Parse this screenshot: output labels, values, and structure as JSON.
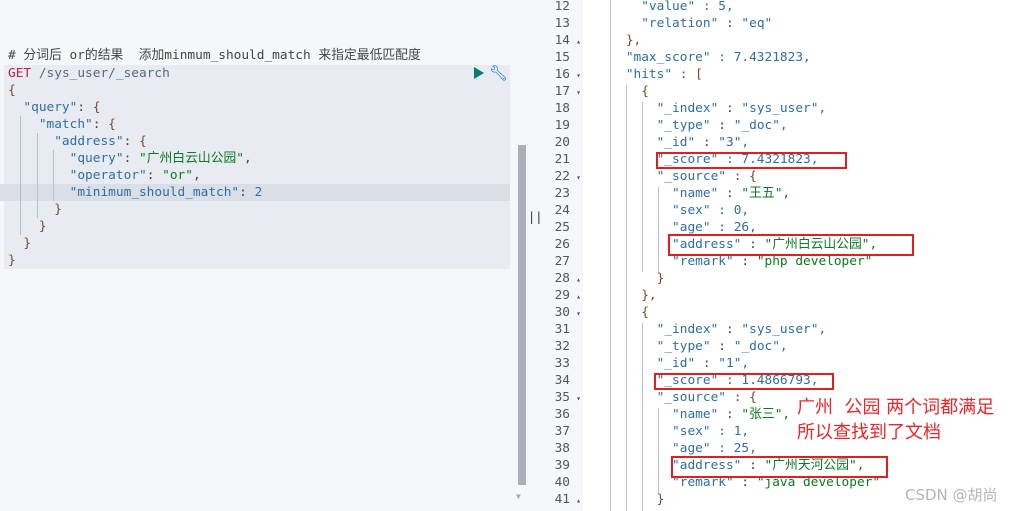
{
  "request": {
    "comment": "# 分词后 or的结果  添加minmum_should_match 来指定最低匹配度",
    "method": "GET",
    "path": " /sys_user/_search",
    "lines": [
      [
        {
          "t": "{",
          "c": "b"
        }
      ],
      [
        {
          "t": "  \"query\"",
          "c": "k"
        },
        {
          "t": ": ",
          "c": "p"
        },
        {
          "t": "{",
          "c": "b"
        }
      ],
      [
        {
          "t": "    \"match\"",
          "c": "k"
        },
        {
          "t": ": ",
          "c": "p"
        },
        {
          "t": "{",
          "c": "b"
        }
      ],
      [
        {
          "t": "      \"address\"",
          "c": "k"
        },
        {
          "t": ": ",
          "c": "p"
        },
        {
          "t": "{",
          "c": "b"
        }
      ],
      [
        {
          "t": "        \"query\"",
          "c": "k"
        },
        {
          "t": ": ",
          "c": "p"
        },
        {
          "t": "\"广州白云山公园\"",
          "c": "cn"
        },
        {
          "t": ",",
          "c": "p"
        }
      ],
      [
        {
          "t": "        \"operator\"",
          "c": "k"
        },
        {
          "t": ": ",
          "c": "p"
        },
        {
          "t": "\"or\"",
          "c": "cn"
        },
        {
          "t": ",",
          "c": "p"
        }
      ],
      [
        {
          "t": "        \"minimum_should_match\"",
          "c": "k"
        },
        {
          "t": ": ",
          "c": "p"
        },
        {
          "t": "2",
          "c": "n"
        }
      ],
      [
        {
          "t": "      }",
          "c": "b"
        }
      ],
      [
        {
          "t": "    }",
          "c": "b"
        }
      ],
      [
        {
          "t": "  }",
          "c": "b"
        }
      ],
      [
        {
          "t": "}",
          "c": "b"
        }
      ]
    ],
    "run_icon": "play-icon",
    "settings_icon": "wrench-icon"
  },
  "divider_label": "||",
  "response": {
    "lines": [
      {
        "n": "12",
        "f": "",
        "parts": [
          {
            "t": "      \"value\"",
            "c": "k"
          },
          {
            "t": " : 5,",
            "c": "n"
          }
        ]
      },
      {
        "n": "13",
        "f": "",
        "parts": [
          {
            "t": "      \"relation\"",
            "c": "k"
          },
          {
            "t": " : ",
            "c": "p"
          },
          {
            "t": "\"eq\"",
            "c": "s"
          }
        ]
      },
      {
        "n": "14",
        "f": "▴",
        "parts": [
          {
            "t": "    },",
            "c": "b"
          }
        ]
      },
      {
        "n": "15",
        "f": "",
        "parts": [
          {
            "t": "    \"max_score\"",
            "c": "k"
          },
          {
            "t": " : 7.4321823,",
            "c": "n"
          }
        ]
      },
      {
        "n": "16",
        "f": "▾",
        "parts": [
          {
            "t": "    \"hits\"",
            "c": "k"
          },
          {
            "t": " : [",
            "c": "b"
          }
        ]
      },
      {
        "n": "17",
        "f": "▾",
        "parts": [
          {
            "t": "      {",
            "c": "b"
          }
        ]
      },
      {
        "n": "18",
        "f": "",
        "parts": [
          {
            "t": "        \"_index\"",
            "c": "k"
          },
          {
            "t": " : ",
            "c": "p"
          },
          {
            "t": "\"sys_user\",",
            "c": "s"
          }
        ]
      },
      {
        "n": "19",
        "f": "",
        "parts": [
          {
            "t": "        \"_type\"",
            "c": "k"
          },
          {
            "t": " : ",
            "c": "p"
          },
          {
            "t": "\"_doc\",",
            "c": "s"
          }
        ]
      },
      {
        "n": "20",
        "f": "",
        "parts": [
          {
            "t": "        \"_id\"",
            "c": "k"
          },
          {
            "t": " : ",
            "c": "p"
          },
          {
            "t": "\"3\",",
            "c": "s"
          }
        ]
      },
      {
        "n": "21",
        "f": "",
        "parts": [
          {
            "t": "        \"_score\"",
            "c": "k"
          },
          {
            "t": " : 7.4321823,",
            "c": "n"
          }
        ]
      },
      {
        "n": "22",
        "f": "▾",
        "parts": [
          {
            "t": "        \"_source\"",
            "c": "k"
          },
          {
            "t": " : {",
            "c": "b"
          }
        ]
      },
      {
        "n": "23",
        "f": "",
        "parts": [
          {
            "t": "          \"name\"",
            "c": "k"
          },
          {
            "t": " : ",
            "c": "p"
          },
          {
            "t": "\"王五\",",
            "c": "cn"
          }
        ]
      },
      {
        "n": "24",
        "f": "",
        "parts": [
          {
            "t": "          \"sex\"",
            "c": "k"
          },
          {
            "t": " : 0,",
            "c": "n"
          }
        ]
      },
      {
        "n": "25",
        "f": "",
        "parts": [
          {
            "t": "          \"age\"",
            "c": "k"
          },
          {
            "t": " : 26,",
            "c": "n"
          }
        ]
      },
      {
        "n": "26",
        "f": "",
        "parts": [
          {
            "t": "          \"address\"",
            "c": "k"
          },
          {
            "t": " : ",
            "c": "p"
          },
          {
            "t": "\"广州白云山公园\",",
            "c": "cn"
          }
        ]
      },
      {
        "n": "27",
        "f": "",
        "parts": [
          {
            "t": "          \"remark\"",
            "c": "k"
          },
          {
            "t": " : ",
            "c": "p"
          },
          {
            "t": "\"php developer\"",
            "c": "cn"
          }
        ]
      },
      {
        "n": "28",
        "f": "▴",
        "parts": [
          {
            "t": "        }",
            "c": "b"
          }
        ]
      },
      {
        "n": "29",
        "f": "▴",
        "parts": [
          {
            "t": "      },",
            "c": "b"
          }
        ]
      },
      {
        "n": "30",
        "f": "▾",
        "parts": [
          {
            "t": "      {",
            "c": "b"
          }
        ]
      },
      {
        "n": "31",
        "f": "",
        "parts": [
          {
            "t": "        \"_index\"",
            "c": "k"
          },
          {
            "t": " : ",
            "c": "p"
          },
          {
            "t": "\"sys_user\",",
            "c": "s"
          }
        ]
      },
      {
        "n": "32",
        "f": "",
        "parts": [
          {
            "t": "        \"_type\"",
            "c": "k"
          },
          {
            "t": " : ",
            "c": "p"
          },
          {
            "t": "\"_doc\",",
            "c": "s"
          }
        ]
      },
      {
        "n": "33",
        "f": "",
        "parts": [
          {
            "t": "        \"_id\"",
            "c": "k"
          },
          {
            "t": " : ",
            "c": "p"
          },
          {
            "t": "\"1\",",
            "c": "s"
          }
        ]
      },
      {
        "n": "34",
        "f": "",
        "parts": [
          {
            "t": "        \"_score\"",
            "c": "k"
          },
          {
            "t": " : 1.4866793,",
            "c": "n"
          }
        ]
      },
      {
        "n": "35",
        "f": "▾",
        "parts": [
          {
            "t": "        \"_source\"",
            "c": "k"
          },
          {
            "t": " : {",
            "c": "b"
          }
        ]
      },
      {
        "n": "36",
        "f": "",
        "parts": [
          {
            "t": "          \"name\"",
            "c": "k"
          },
          {
            "t": " : ",
            "c": "p"
          },
          {
            "t": "\"张三\",",
            "c": "cn"
          }
        ]
      },
      {
        "n": "37",
        "f": "",
        "parts": [
          {
            "t": "          \"sex\"",
            "c": "k"
          },
          {
            "t": " : 1,",
            "c": "n"
          }
        ]
      },
      {
        "n": "38",
        "f": "",
        "parts": [
          {
            "t": "          \"age\"",
            "c": "k"
          },
          {
            "t": " : 25,",
            "c": "n"
          }
        ]
      },
      {
        "n": "39",
        "f": "",
        "parts": [
          {
            "t": "          \"address\"",
            "c": "k"
          },
          {
            "t": " : ",
            "c": "p"
          },
          {
            "t": "\"广州天河公园\",",
            "c": "cn"
          }
        ]
      },
      {
        "n": "40",
        "f": "",
        "parts": [
          {
            "t": "          \"remark\"",
            "c": "k"
          },
          {
            "t": " : ",
            "c": "p"
          },
          {
            "t": "\"java developer\"",
            "c": "cn"
          }
        ]
      },
      {
        "n": "41",
        "f": "▴",
        "parts": [
          {
            "t": "        }",
            "c": "b"
          }
        ]
      }
    ]
  },
  "annotation": "广州  公园 两个词都满足\n所以查找到了文档",
  "watermark": "CSDN @胡尚",
  "colors": {
    "highlight_box": "#e02020",
    "annotation": "#e8262a",
    "run": "#017d73"
  }
}
